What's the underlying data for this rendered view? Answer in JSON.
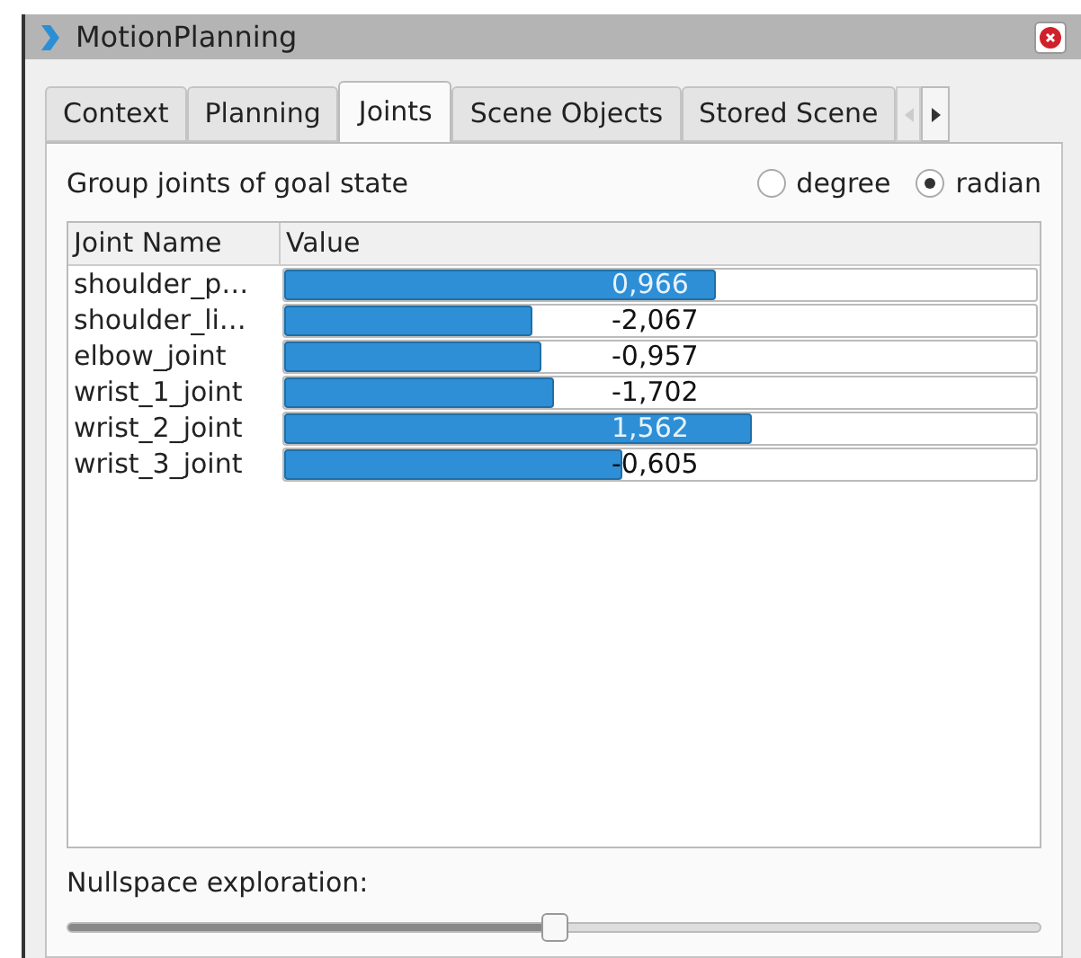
{
  "window": {
    "title": "MotionPlanning"
  },
  "tabs": [
    {
      "label": "Context",
      "selected": false
    },
    {
      "label": "Planning",
      "selected": false
    },
    {
      "label": "Joints",
      "selected": true
    },
    {
      "label": "Scene Objects",
      "selected": false
    },
    {
      "label": "Stored Scene",
      "selected": false
    }
  ],
  "heading": "Group joints of goal state",
  "units": [
    {
      "label": "degree",
      "selected": false
    },
    {
      "label": "radian",
      "selected": true
    }
  ],
  "table": {
    "columns": [
      "Joint Name",
      "Value"
    ],
    "rows": [
      {
        "name": "shoulder_p…",
        "value": "0,966",
        "level": 0.574
      },
      {
        "name": "shoulder_li…",
        "value": "-2,067",
        "level": 0.331
      },
      {
        "name": "elbow_joint",
        "value": "-0,957",
        "level": 0.343
      },
      {
        "name": "wrist_1_joint",
        "value": "-1,702",
        "level": 0.36
      },
      {
        "name": "wrist_2_joint",
        "value": "1,562",
        "level": 0.621
      },
      {
        "name": "wrist_3_joint",
        "value": "-0,605",
        "level": 0.45
      }
    ]
  },
  "nullspace": {
    "label": "Nullspace exploration:",
    "level": 0.5
  }
}
